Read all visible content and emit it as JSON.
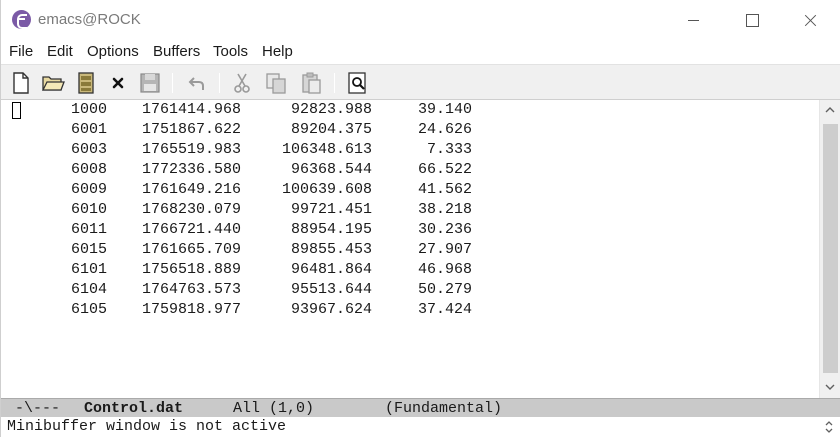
{
  "window": {
    "title": "emacs@ROCK",
    "icon": "emacs-icon"
  },
  "menubar": {
    "items": [
      "File",
      "Edit",
      "Options",
      "Buffers",
      "Tools",
      "Help"
    ]
  },
  "toolbar": {
    "buttons": [
      "new-file-icon",
      "open-folder-icon",
      "open-directory-icon",
      "close-buffer-icon",
      "save-icon",
      "undo-icon",
      "cut-icon",
      "copy-icon",
      "paste-icon",
      "search-icon"
    ]
  },
  "buffer": {
    "lines": [
      {
        "id": "1000",
        "c1": "1761414.968",
        "c2": "92823.988",
        "c3": "39.140"
      },
      {
        "id": "6001",
        "c1": "1751867.622",
        "c2": "89204.375",
        "c3": "24.626"
      },
      {
        "id": "6003",
        "c1": "1765519.983",
        "c2": "106348.613",
        "c3": "7.333"
      },
      {
        "id": "6008",
        "c1": "1772336.580",
        "c2": "96368.544",
        "c3": "66.522"
      },
      {
        "id": "6009",
        "c1": "1761649.216",
        "c2": "100639.608",
        "c3": "41.562"
      },
      {
        "id": "6010",
        "c1": "1768230.079",
        "c2": "99721.451",
        "c3": "38.218"
      },
      {
        "id": "6011",
        "c1": "1766721.440",
        "c2": "88954.195",
        "c3": "30.236"
      },
      {
        "id": "6015",
        "c1": "1761665.709",
        "c2": "89855.453",
        "c3": "27.907"
      },
      {
        "id": "6101",
        "c1": "1756518.889",
        "c2": "96481.864",
        "c3": "46.968"
      },
      {
        "id": "6104",
        "c1": "1764763.573",
        "c2": "95513.644",
        "c3": "50.279"
      },
      {
        "id": "6105",
        "c1": "1759818.977",
        "c2": "93967.624",
        "c3": "37.424"
      }
    ]
  },
  "modeline": {
    "status": "-\\---",
    "buffer_name": "Control.dat",
    "position": "All (1,0)",
    "mode": "(Fundamental)"
  },
  "minibuffer": {
    "message": "Minibuffer window is not active"
  }
}
